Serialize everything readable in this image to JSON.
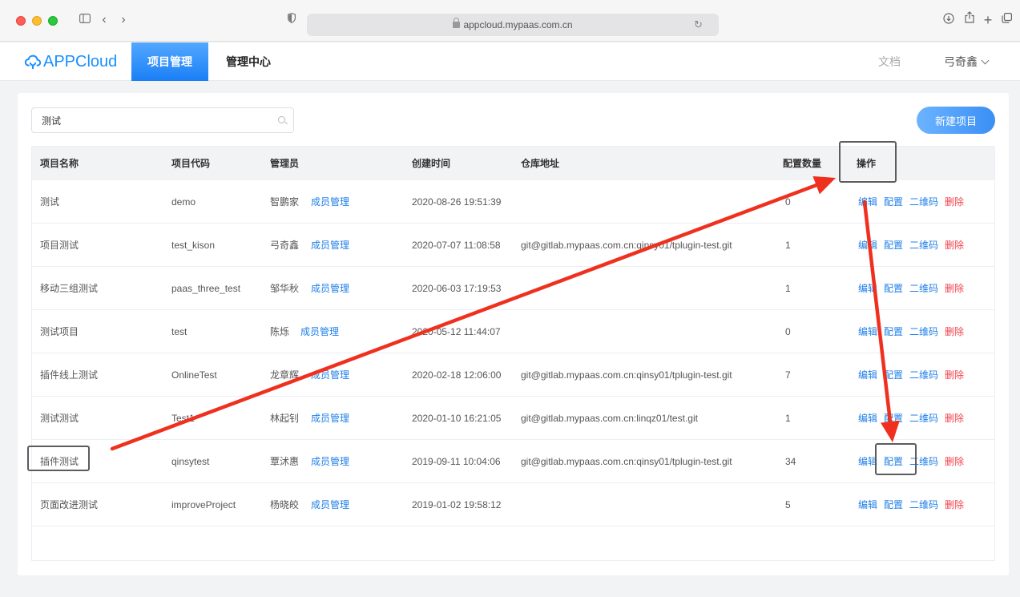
{
  "browser": {
    "url": "appcloud.mypaas.com.cn"
  },
  "header": {
    "logo": "APPCloud",
    "tabs": [
      {
        "label": "项目管理",
        "active": true
      },
      {
        "label": "管理中心",
        "active": false
      }
    ],
    "docs_label": "文档",
    "user_name": "弓奇鑫"
  },
  "toolbar": {
    "search_value": "测试",
    "new_button_label": "新建项目"
  },
  "table": {
    "columns": [
      "项目名称",
      "项目代码",
      "管理员",
      "创建时间",
      "仓库地址",
      "配置数量",
      "操作"
    ],
    "member_link_label": "成员管理",
    "actions": {
      "edit": "编辑",
      "config": "配置",
      "qrcode": "二维码",
      "delete": "删除"
    },
    "rows": [
      {
        "name": "测试",
        "code": "demo",
        "admin": "智鹏家",
        "created": "2020-08-26 19:51:39",
        "repo": "",
        "config_count": "0"
      },
      {
        "name": "项目测试",
        "code": "test_kison",
        "admin": "弓奇鑫",
        "created": "2020-07-07 11:08:58",
        "repo": "git@gitlab.mypaas.com.cn:qinsy01/tplugin-test.git",
        "config_count": "1"
      },
      {
        "name": "移动三组测试",
        "code": "paas_three_test",
        "admin": "邹华秋",
        "created": "2020-06-03 17:19:53",
        "repo": "",
        "config_count": "1"
      },
      {
        "name": "测试项目",
        "code": "test",
        "admin": "陈烁",
        "created": "2020-05-12 11:44:07",
        "repo": "",
        "config_count": "0"
      },
      {
        "name": "插件线上测试",
        "code": "OnlineTest",
        "admin": "龙章辉",
        "created": "2020-02-18 12:06:00",
        "repo": "git@gitlab.mypaas.com.cn:qinsy01/tplugin-test.git",
        "config_count": "7"
      },
      {
        "name": "测试测试",
        "code": "Test1",
        "admin": "林起钊",
        "created": "2020-01-10 16:21:05",
        "repo": "git@gitlab.mypaas.com.cn:linqz01/test.git",
        "config_count": "1"
      },
      {
        "name": "插件测试",
        "code": "qinsytest",
        "admin": "覃沭惠",
        "created": "2019-09-11 10:04:06",
        "repo": "git@gitlab.mypaas.com.cn:qinsy01/tplugin-test.git",
        "config_count": "34"
      },
      {
        "name": "页面改进测试",
        "code": "improveProject",
        "admin": "杨晓皎",
        "created": "2019-01-02 19:58:12",
        "repo": "",
        "config_count": "5"
      }
    ]
  },
  "annotations": {
    "arrow_color": "#f0301e",
    "box_color": "#5c5c5c"
  }
}
